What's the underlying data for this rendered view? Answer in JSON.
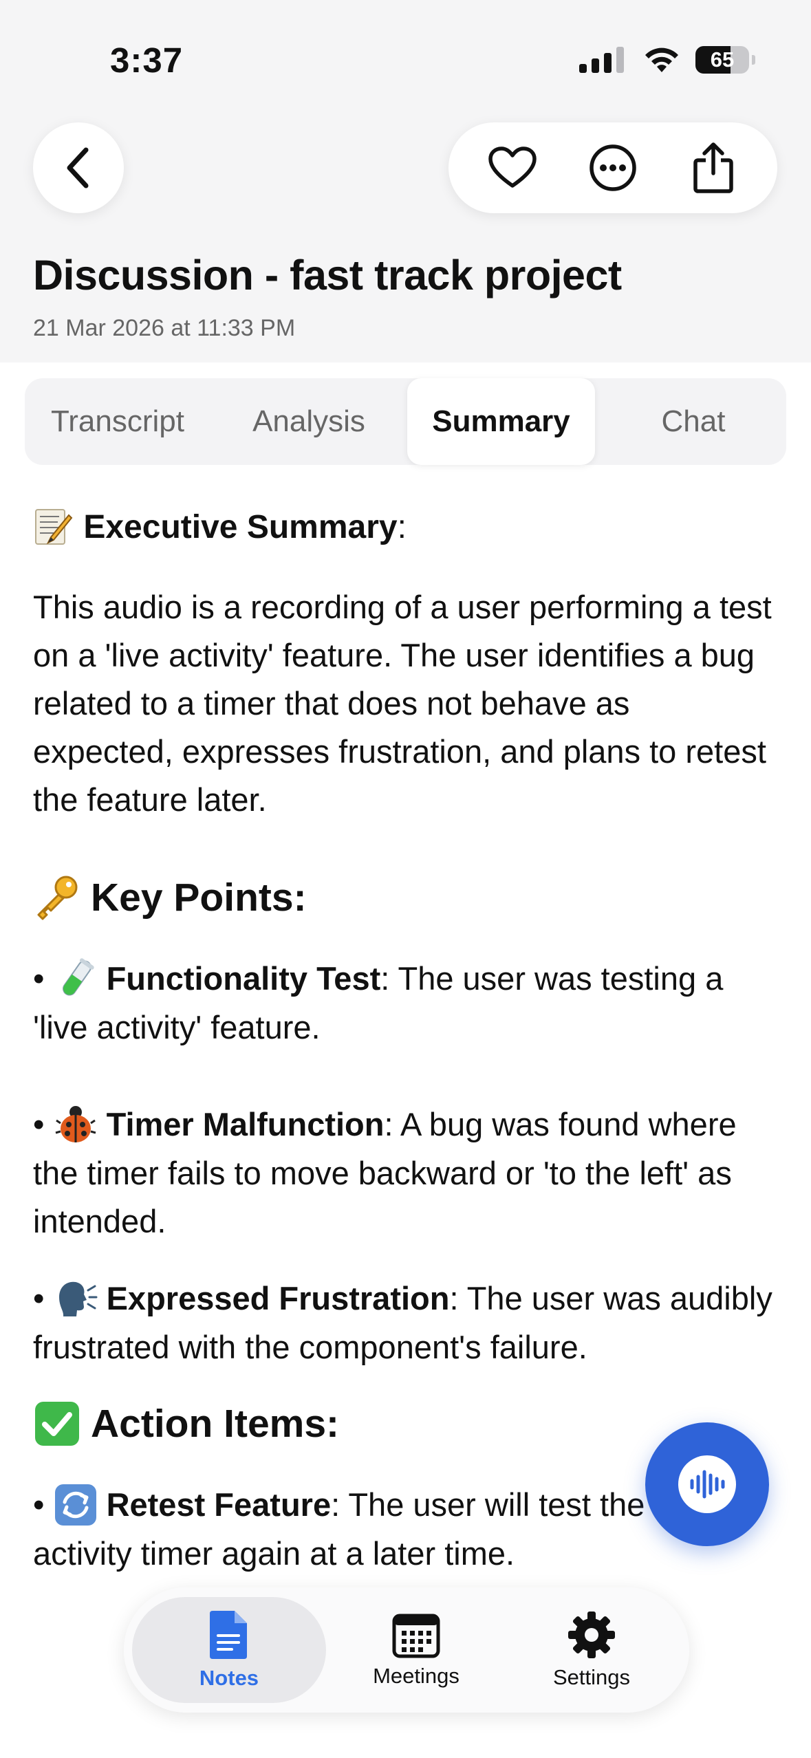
{
  "status_bar": {
    "time": "3:37",
    "battery": "65",
    "battery_level": 0.65
  },
  "nav": {
    "back_icon": "chevron-left-icon",
    "actions": [
      "heart-icon",
      "ellipsis-icon",
      "share-icon"
    ]
  },
  "note": {
    "title": "Discussion - fast track project",
    "datetime": "21 Mar 2026 at 11:33 PM"
  },
  "tabs": [
    {
      "label": "Transcript",
      "active": false
    },
    {
      "label": "Analysis",
      "active": false
    },
    {
      "label": "Summary",
      "active": true
    },
    {
      "label": "Chat",
      "active": false
    }
  ],
  "summary": {
    "executive": {
      "heading": "Executive Summary",
      "colon": ":",
      "body": "This audio is a recording of a user performing a test on a 'live activity' feature. The user identifies a bug related to a timer that does not behave as expected, expresses frustration, and plans to retest the feature later."
    },
    "key_points": {
      "heading": "Key Points:",
      "items": [
        {
          "title": "Functionality Test",
          "text": ": The user was testing a 'live activity' feature."
        },
        {
          "title": "Timer Malfunction",
          "text": ": A bug was found where the timer fails to move backward or 'to the left' as intended."
        },
        {
          "title": "Expressed Frustration",
          "text": ": The user was audibly frustrated with the component's failure."
        }
      ]
    },
    "action_items": {
      "heading": "Action Items:",
      "items": [
        {
          "title": "Retest Feature",
          "text": ": The user will test the live activity timer again at a later time."
        }
      ]
    }
  },
  "fab": {
    "icon": "waveform-icon"
  },
  "bottom_tabs": [
    {
      "label": "Notes",
      "icon": "notes-icon",
      "active": true
    },
    {
      "label": "Meetings",
      "icon": "calendar-icon",
      "active": false
    },
    {
      "label": "Settings",
      "icon": "gear-icon",
      "active": false
    }
  ],
  "colors": {
    "accent": "#2f63d8",
    "active_tab_text": "#2f6fe6",
    "header_bg": "#f5f5f6"
  }
}
